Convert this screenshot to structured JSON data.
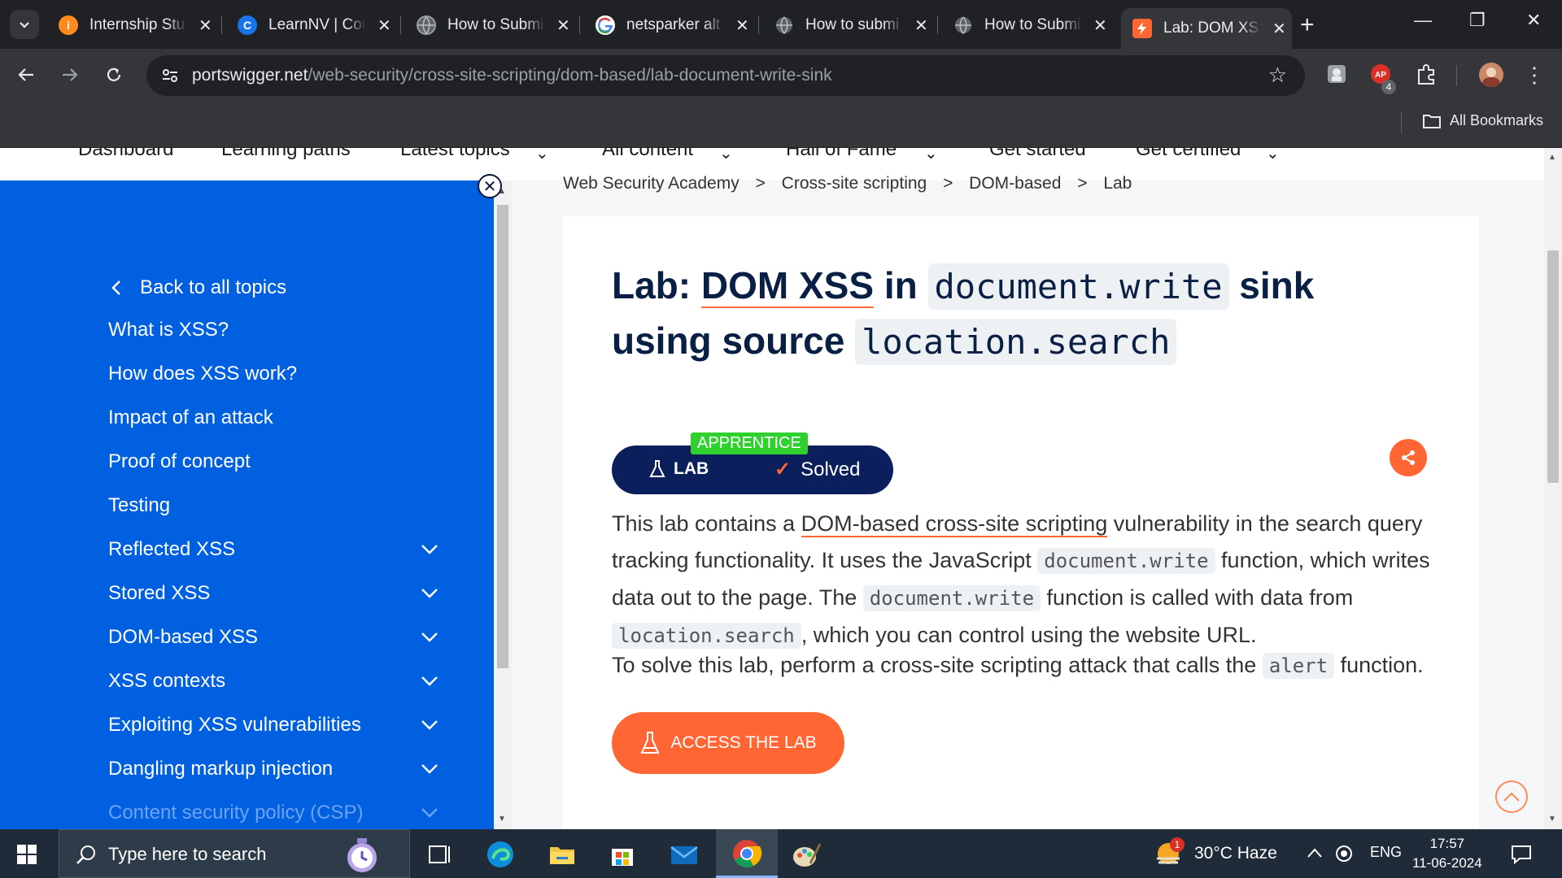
{
  "browser": {
    "tabs": [
      {
        "title": "Internship Stu",
        "favicon": "info-icon",
        "color": "#ff8a1e"
      },
      {
        "title": "LearnNV | Cou",
        "favicon": "c-logo-icon",
        "color": "#1a73e8"
      },
      {
        "title": "How to Submi",
        "favicon": "globe-icon",
        "color": "#9aa0a6"
      },
      {
        "title": "netsparker alt",
        "favicon": "google-icon",
        "color": "#ffffff"
      },
      {
        "title": "How to submi",
        "favicon": "globe-icon",
        "color": "#9aa0a6"
      },
      {
        "title": "How to Submi",
        "favicon": "globe-icon",
        "color": "#9aa0a6"
      },
      {
        "title": "Lab: DOM XSS",
        "favicon": "portswigger-icon",
        "color": "#ff6633",
        "active": true
      }
    ],
    "url_host": "portswigger.net",
    "url_path": "/web-security/cross-site-scripting/dom-based/lab-document-write-sink",
    "extension_badge": "4",
    "bookmarks_label": "All Bookmarks"
  },
  "topnav": {
    "items": [
      "Dashboard",
      "Learning paths",
      "Latest topics",
      "All content",
      "Hall of Fame",
      "Get started",
      "Get certified"
    ]
  },
  "sidebar": {
    "back_label": "Back to all topics",
    "items": [
      {
        "label": "What is XSS?",
        "expandable": false
      },
      {
        "label": "How does XSS work?",
        "expandable": false
      },
      {
        "label": "Impact of an attack",
        "expandable": false
      },
      {
        "label": "Proof of concept",
        "expandable": false
      },
      {
        "label": "Testing",
        "expandable": false
      },
      {
        "label": "Reflected XSS",
        "expandable": true
      },
      {
        "label": "Stored XSS",
        "expandable": true
      },
      {
        "label": "DOM-based XSS",
        "expandable": true
      },
      {
        "label": "XSS contexts",
        "expandable": true
      },
      {
        "label": "Exploiting XSS vulnerabilities",
        "expandable": true
      },
      {
        "label": "Dangling markup injection",
        "expandable": true
      },
      {
        "label": "Content security policy (CSP)",
        "expandable": true
      }
    ]
  },
  "breadcrumb": {
    "items": [
      "Web Security Academy",
      "Cross-site scripting",
      "DOM-based",
      "Lab"
    ],
    "separator": ">"
  },
  "lab": {
    "title_prefix": "Lab: ",
    "title_link": "DOM XSS",
    "title_in": " in ",
    "title_code1": "document.write",
    "title_sink": " sink",
    "title_using": "using source ",
    "title_code2": "location.search",
    "level": "APPRENTICE",
    "lab_label": "LAB",
    "status": "Solved",
    "para1": {
      "t1": "This lab contains a ",
      "link": "DOM-based cross-site scripting",
      "t2": " vulnerability in the search query tracking functionality. It uses the JavaScript ",
      "code1": "document.write",
      "t3": " function, which writes data out to the page. The ",
      "code2": "document.write",
      "t4": " function is called with data from ",
      "code3": "location.search",
      "t5": ", which you can control using the website URL."
    },
    "para2": {
      "t1": "To solve this lab, perform a cross-site scripting attack that calls the ",
      "code": "alert",
      "t2": " function."
    },
    "access_button": "ACCESS THE LAB"
  },
  "colors": {
    "accent": "#ff6633",
    "sidebar": "#0060e0",
    "navy": "#0a1f44",
    "apprentice": "#2fd12f"
  },
  "taskbar": {
    "search_placeholder": "Type here to search",
    "weather": "30°C  Haze",
    "weather_badge": "1",
    "language": "ENG",
    "time": "17:57",
    "date": "11-06-2024"
  }
}
